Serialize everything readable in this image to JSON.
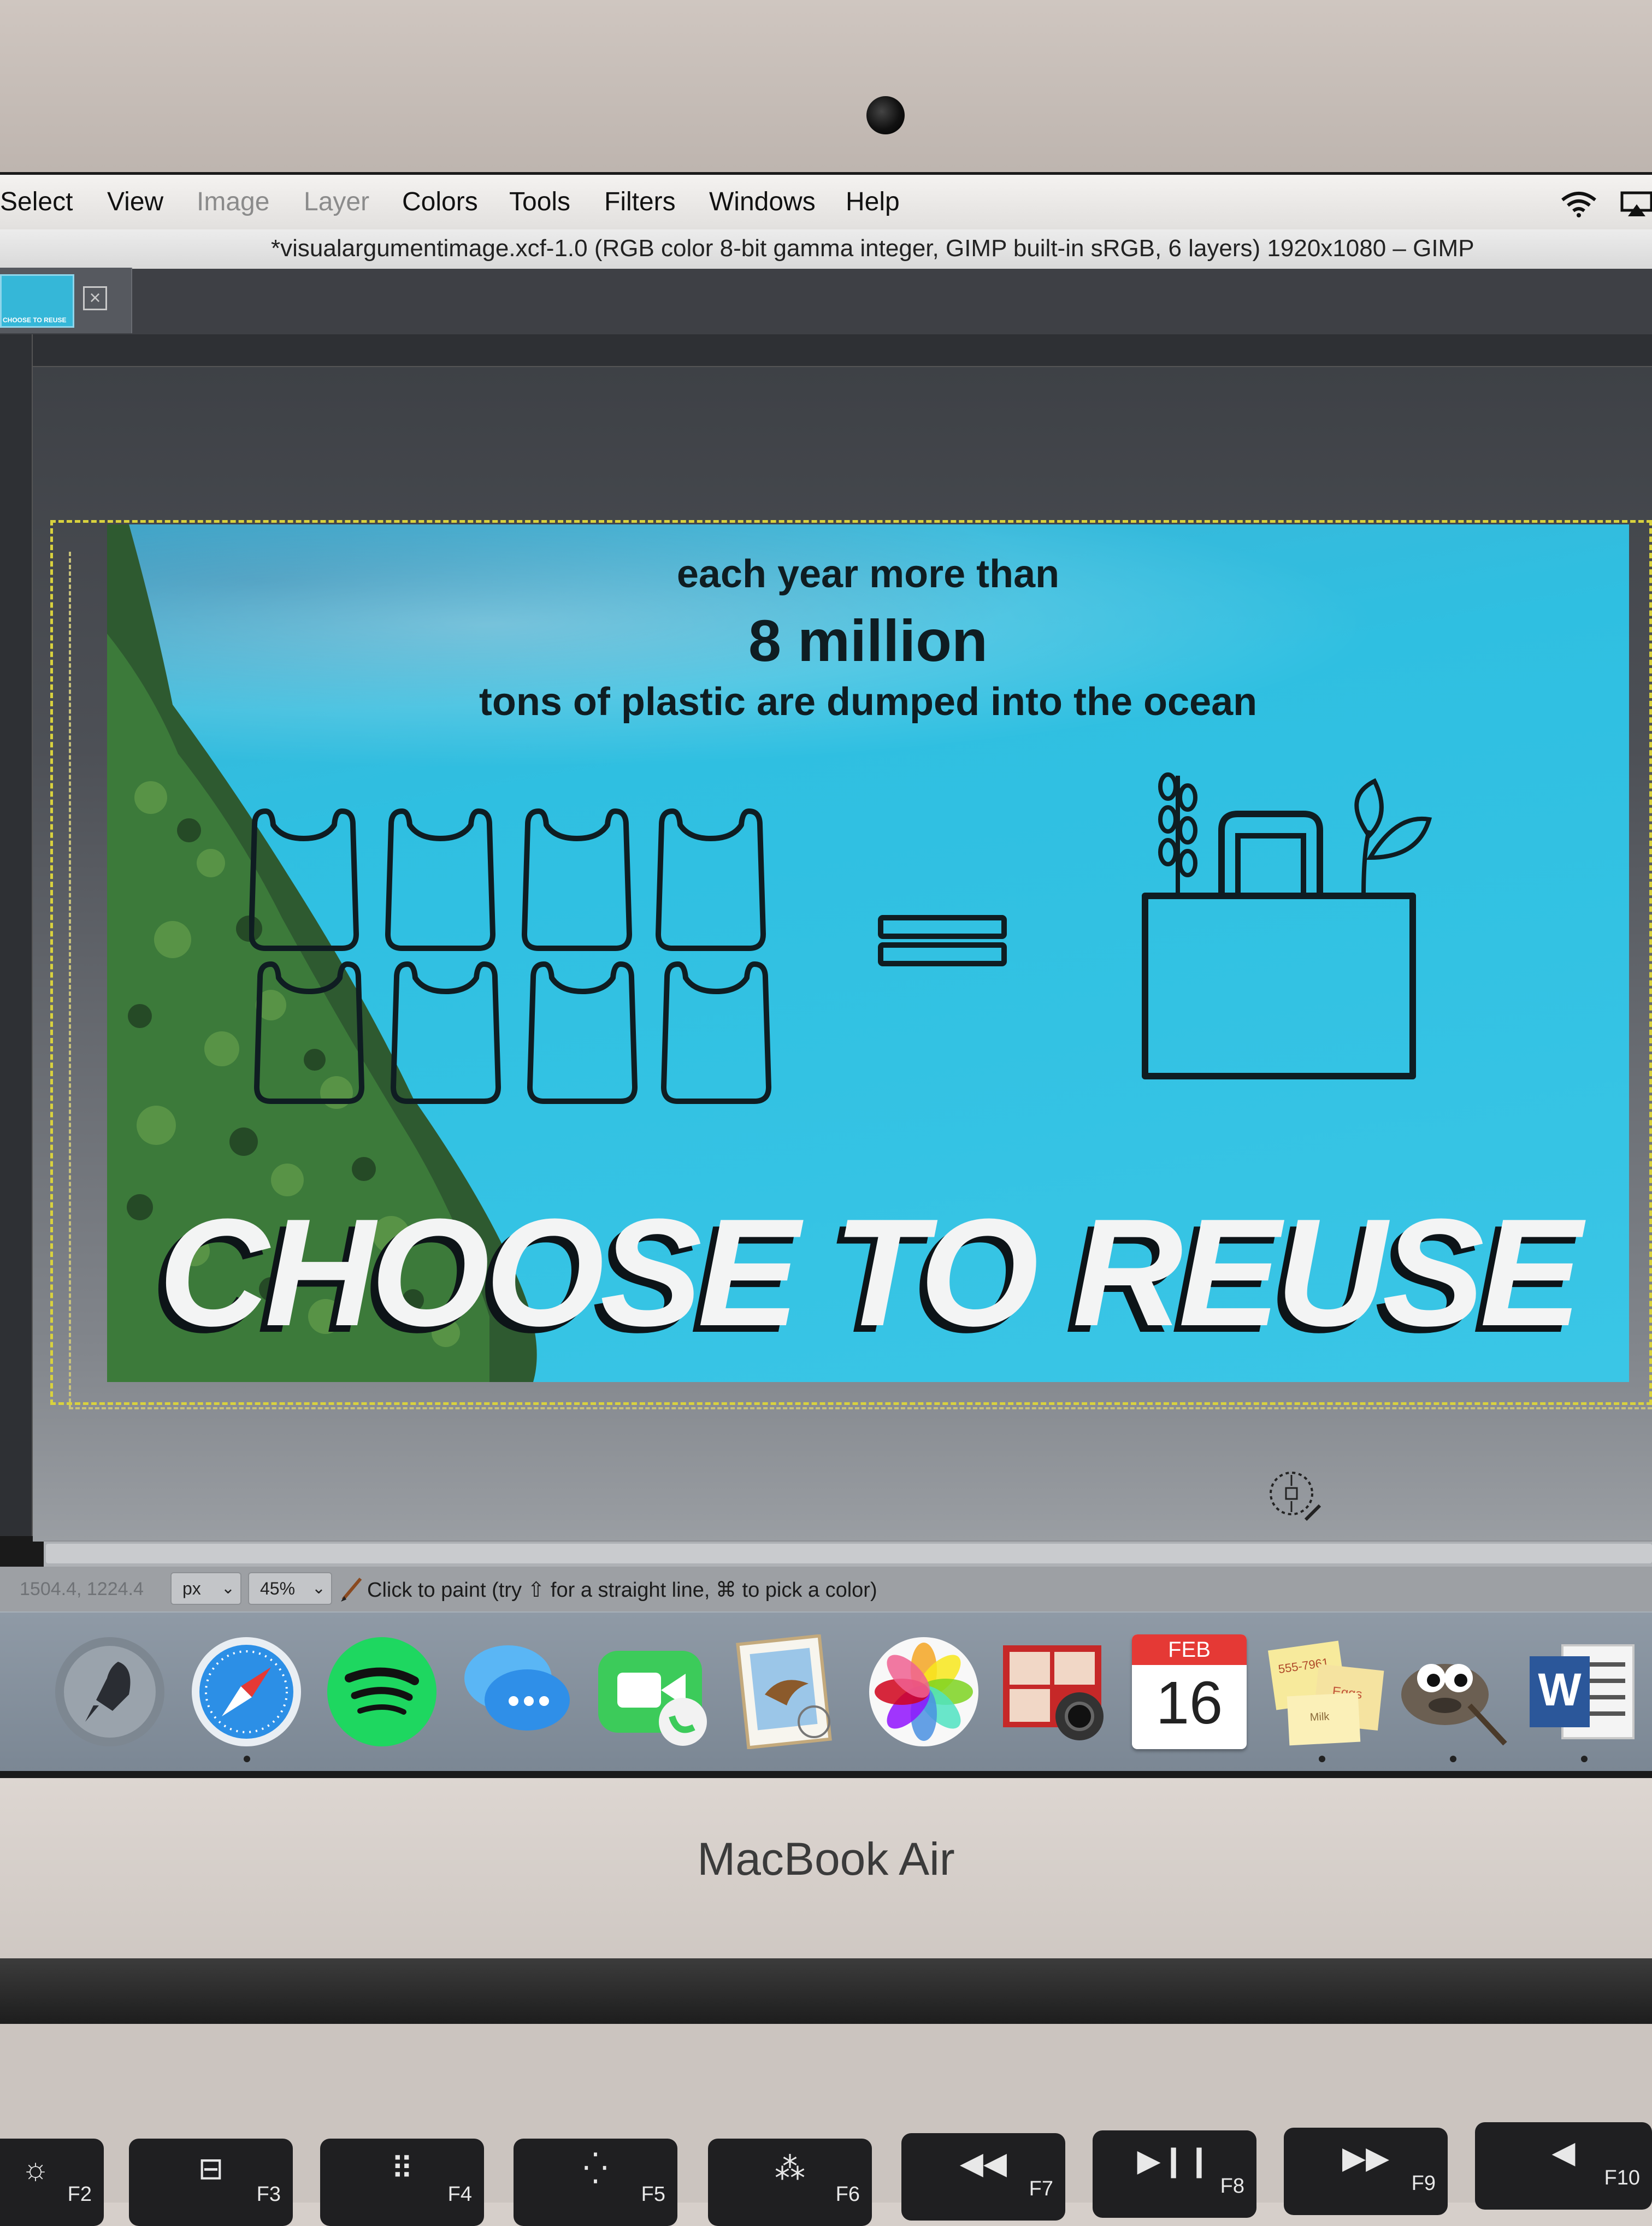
{
  "menubar": {
    "items": [
      {
        "label": "Select",
        "enabled": true
      },
      {
        "label": "View",
        "enabled": true
      },
      {
        "label": "Image",
        "enabled": false
      },
      {
        "label": "Layer",
        "enabled": false
      },
      {
        "label": "Colors",
        "enabled": true
      },
      {
        "label": "Tools",
        "enabled": true
      },
      {
        "label": "Filters",
        "enabled": true
      },
      {
        "label": "Windows",
        "enabled": true
      },
      {
        "label": "Help",
        "enabled": true
      }
    ],
    "status_icons": [
      "wifi-icon",
      "airplay-icon"
    ]
  },
  "window": {
    "title": "*visualargumentimage.xcf-1.0 (RGB color 8-bit gamma integer, GIMP built-in sRGB, 6 layers) 1920x1080 – GIMP"
  },
  "image_tab": {
    "thumbnail_caption": "CHOOSE TO REUSE",
    "close_icon": "close-icon"
  },
  "poster": {
    "line1": "each year more than",
    "line2": "8 million",
    "line3": "tons of plastic are dumped into the ocean",
    "slogan": "CHOOSE TO REUSE",
    "background_color": "#33c2e3",
    "plastic_bag_count": 8,
    "icons": [
      "plastic-bag-icon",
      "equals-icon",
      "tote-bag-icon"
    ]
  },
  "statusbar": {
    "coordinates": "1504.4, 1224.4",
    "unit": "px",
    "zoom": "45%",
    "message": "Click to paint (try ⇧ for a straight line, ⌘ to pick a color)"
  },
  "dock": {
    "apps": [
      {
        "name": "launchpad-icon",
        "running": false
      },
      {
        "name": "safari-icon",
        "running": true
      },
      {
        "name": "spotify-icon",
        "running": false
      },
      {
        "name": "messages-icon",
        "running": false
      },
      {
        "name": "facetime-icon",
        "running": false
      },
      {
        "name": "mail-icon",
        "running": false
      },
      {
        "name": "photos-icon",
        "running": false
      },
      {
        "name": "photo-booth-icon",
        "running": false
      },
      {
        "name": "calendar-icon",
        "running": false,
        "month": "FEB",
        "day": "16"
      },
      {
        "name": "stickies-icon",
        "running": true,
        "note1": "555-7961",
        "note2": "Eggs",
        "note3": "Milk"
      },
      {
        "name": "gimp-icon",
        "running": true
      },
      {
        "name": "word-icon",
        "running": true
      }
    ]
  },
  "device": {
    "label": "MacBook Air"
  },
  "keyboard": {
    "keys": [
      "F2",
      "F3",
      "F4",
      "F5",
      "F6",
      "F7",
      "F8",
      "F9",
      "F10"
    ]
  }
}
